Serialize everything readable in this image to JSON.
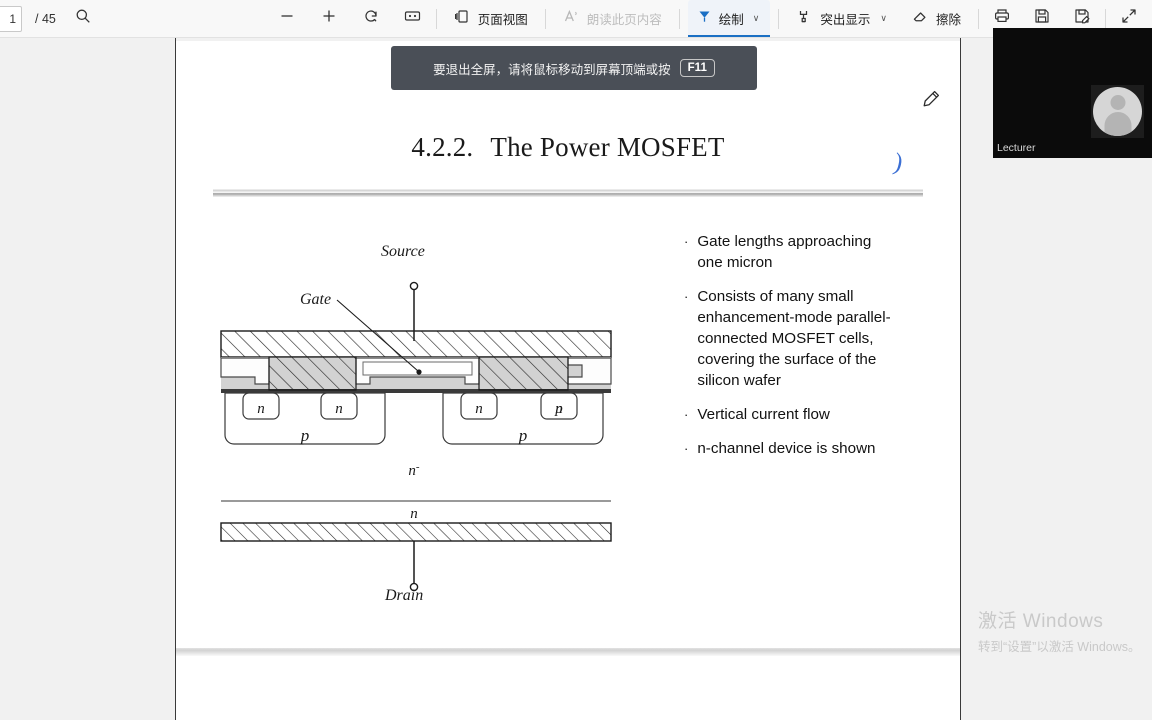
{
  "toolbar": {
    "page_current": "1",
    "page_total": "/ 45",
    "search_icon": "search-icon",
    "zoom_out_label": "−",
    "zoom_in_label": "+",
    "rotate_icon": "rotate-icon",
    "fit_icon": "fit-page-icon",
    "page_view_label": "页面视图",
    "read_aloud_label": "朗读此页内容",
    "draw_label": "绘制",
    "highlight_label": "突出显示",
    "erase_label": "擦除",
    "print_icon": "print-icon",
    "save_icon": "save-icon",
    "save_as_icon": "save-as-icon",
    "expand_icon": "expand-icon",
    "chevron": "∨",
    "accent_color": "#1a6fc4",
    "active_tab_bg": "#eff3f9"
  },
  "banner": {
    "message": "要退出全屏，请将鼠标移动到屏幕顶端或按",
    "key": "F11"
  },
  "slide": {
    "section_number": "4.2.2.",
    "title": "The Power MOSFET",
    "ink_annotation": ")",
    "pencil_icon": "pencil-icon",
    "bullets": [
      "Gate lengths approaching one micron",
      "Consists of many small enhancement-mode parallel-connected MOSFET cells, covering the surface of the silicon wafer",
      "Vertical current flow",
      "n-channel device is shown"
    ],
    "bullet_marker": "·",
    "diagram": {
      "source_label": "Source",
      "gate_label": "Gate",
      "drain_label": "Drain",
      "n_labels": [
        "n",
        "n",
        "n",
        "n"
      ],
      "p_labels": [
        "p",
        "p"
      ],
      "substrate_drift_label": "n",
      "substrate_drift_sup": "-",
      "substrate_label": "n"
    }
  },
  "video": {
    "participant_name": "Lecturer",
    "avatar_icon": "person-avatar-icon"
  },
  "watermark": {
    "title": "激活 Windows",
    "subtitle": "转到“设置”以激活 Windows。"
  }
}
